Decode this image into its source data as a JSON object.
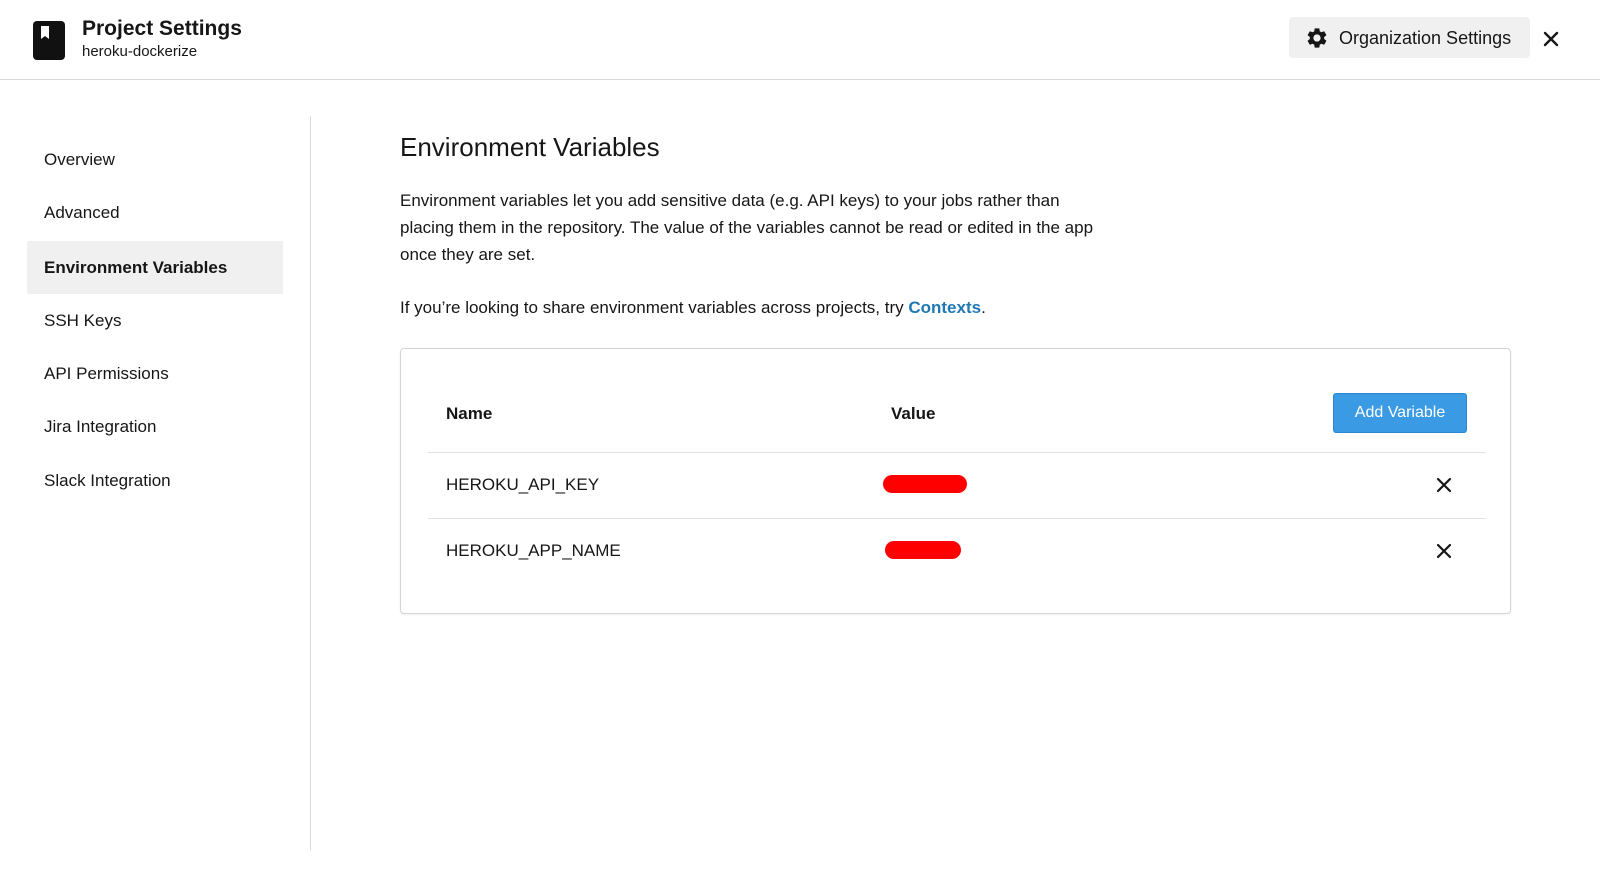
{
  "header": {
    "title": "Project Settings",
    "subtitle": "heroku-dockerize",
    "org_settings_label": "Organization Settings",
    "logo_icon": "bookmark-icon",
    "close_icon": "close-icon"
  },
  "sidebar": {
    "items": [
      {
        "label": "Overview",
        "active": false
      },
      {
        "label": "Advanced",
        "active": false
      },
      {
        "label": "Environment Variables",
        "active": true
      },
      {
        "label": "SSH Keys",
        "active": false
      },
      {
        "label": "API Permissions",
        "active": false
      },
      {
        "label": "Jira Integration",
        "active": false
      },
      {
        "label": "Slack Integration",
        "active": false
      }
    ]
  },
  "main": {
    "title": "Environment Variables",
    "description": "Environment variables let you add sensitive data (e.g. API keys) to your jobs rather than placing them in the repository. The value of the variables cannot be read or edited in the app once they are set.",
    "hint_prefix": "If you’re looking to share environment variables across projects, try ",
    "hint_link": "Contexts",
    "hint_suffix": "."
  },
  "table": {
    "columns": {
      "name": "Name",
      "value": "Value"
    },
    "add_button_label": "Add Variable",
    "rows": [
      {
        "name": "HEROKU_API_KEY"
      },
      {
        "name": "HEROKU_APP_NAME"
      }
    ]
  },
  "colors": {
    "accent": "#3a9ae4",
    "link": "#1f78b4",
    "redaction": "#ff0000",
    "active_bg": "#f0f0f0"
  }
}
